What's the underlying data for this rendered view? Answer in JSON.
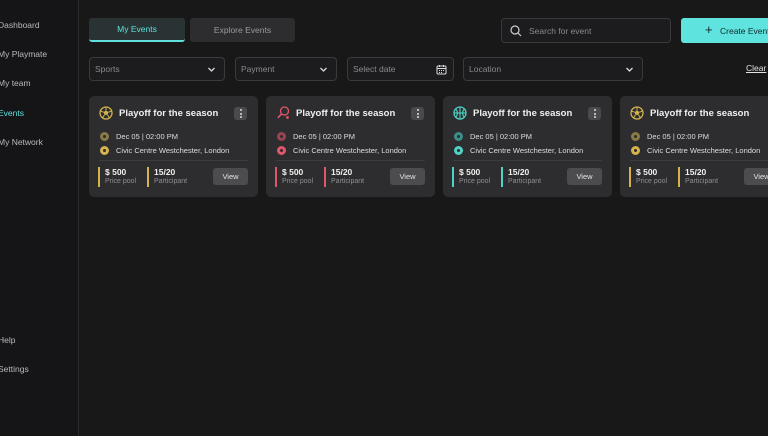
{
  "sidebar": {
    "items": [
      {
        "label": "Dashboard",
        "active": false
      },
      {
        "label": "My Playmate",
        "active": false
      },
      {
        "label": "My team",
        "active": false
      },
      {
        "label": "Events",
        "active": true
      },
      {
        "label": "My Network",
        "active": false
      }
    ],
    "bottom_items": [
      {
        "label": "Help"
      },
      {
        "label": "Settings"
      }
    ]
  },
  "tabs": {
    "my_events": "My Events",
    "explore_events": "Explore Events"
  },
  "search": {
    "placeholder": "Search for event",
    "value": ""
  },
  "create_button": {
    "label": "Create Event"
  },
  "filters": {
    "sports": "Sports",
    "payment": "Payment",
    "date": "Select date",
    "location": "Location",
    "clear": "Clear"
  },
  "colors": {
    "accent": "#5fe0dc",
    "gold": "#d4b24c",
    "red": "#e0566a",
    "teal": "#4fd1c5"
  },
  "cards": [
    {
      "sport_icon": "soccer-ball-icon",
      "color": "#d4b24c",
      "title": "Playoff for the season",
      "date": "Dec 05 | 02:00 PM",
      "location": "Civic Centre Westchester, London",
      "price": "$ 500",
      "price_label": "Price pool",
      "participants": "15/20",
      "participants_label": "Participant",
      "view": "View"
    },
    {
      "sport_icon": "tennis-racket-icon",
      "color": "#e0566a",
      "title": "Playoff for the season",
      "date": "Dec 05 | 02:00 PM",
      "location": "Civic Centre Westchester, London",
      "price": "$ 500",
      "price_label": "Price pool",
      "participants": "15/20",
      "participants_label": "Participant",
      "view": "View"
    },
    {
      "sport_icon": "basketball-icon",
      "color": "#4fd1c5",
      "title": "Playoff for the season",
      "date": "Dec 05 | 02:00 PM",
      "location": "Civic Centre Westchester, London",
      "price": "$ 500",
      "price_label": "Price pool",
      "participants": "15/20",
      "participants_label": "Participant",
      "view": "View"
    },
    {
      "sport_icon": "soccer-ball-icon",
      "color": "#d4b24c",
      "title": "Playoff for the season",
      "date": "Dec 05 | 02:00 PM",
      "location": "Civic Centre Westchester, London",
      "price": "$ 500",
      "price_label": "Price pool",
      "participants": "15/20",
      "participants_label": "Participant",
      "view": "View"
    }
  ]
}
